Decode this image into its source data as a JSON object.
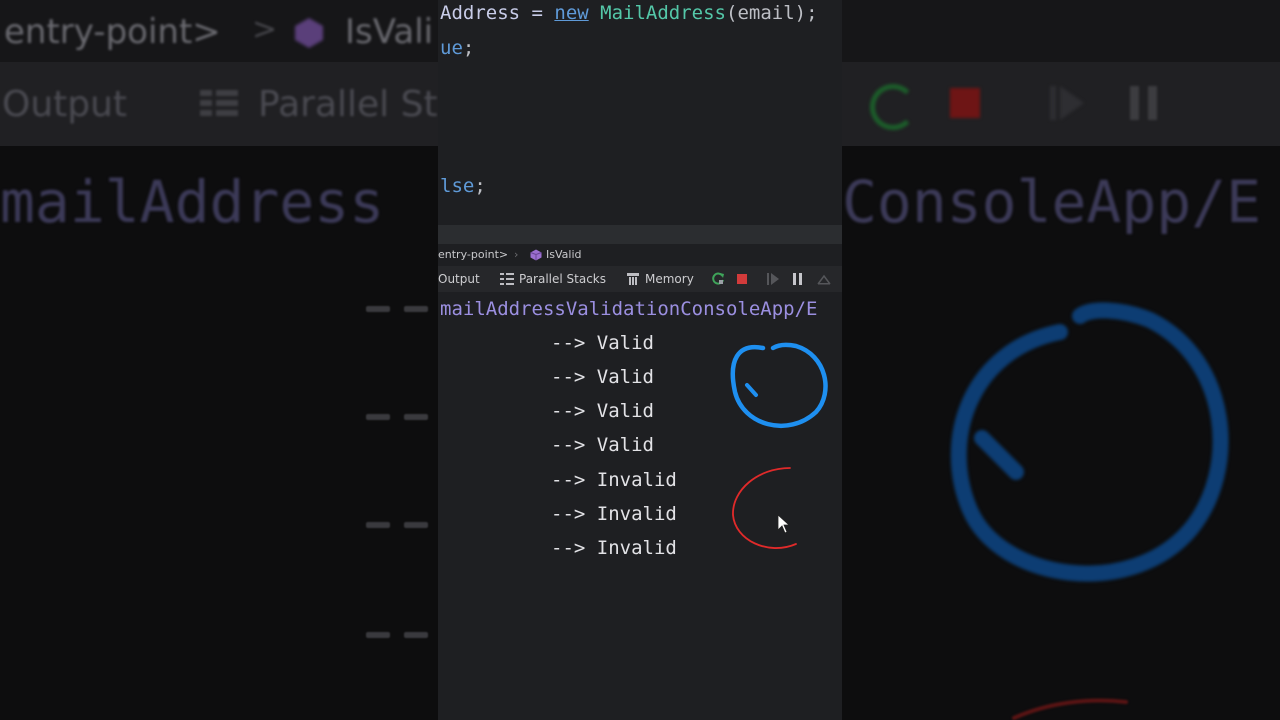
{
  "background": {
    "breadcrumb_left": "entry-point>",
    "breadcrumb_sep": ">",
    "breadcrumb_right": "IsVali",
    "tab_output": "Output",
    "tab_parallel": "Parallel St",
    "path_left": "mailAddress",
    "path_right": "ConsoleApp/E"
  },
  "editor": {
    "lines": [
      {
        "pre": "Address = ",
        "kw": "new",
        "cls": " MailAddress",
        "rest": "(email);"
      },
      {
        "kw": "ue",
        "rest": ";"
      },
      {
        "kw": "lse",
        "rest": ";"
      }
    ]
  },
  "breadcrumb": {
    "entry": "entry-point>",
    "sep": "›",
    "method": "IsValid",
    "method_icon": "method-cube-icon"
  },
  "toolbar": {
    "output": "Output",
    "parallel_stacks": "Parallel Stacks",
    "memory": "Memory",
    "icons": [
      "rerun-icon",
      "stop-icon",
      "resume-icon",
      "pause-icon",
      "step-icon"
    ],
    "colors": {
      "rerun": "#3fa45a",
      "stop": "#d23b3b"
    }
  },
  "console": {
    "path": "mailAddressValidationConsoleApp/E",
    "results": [
      "--> Valid",
      "--> Valid",
      "--> Valid",
      "--> Valid",
      "--> Invalid",
      "--> Invalid",
      "--> Invalid"
    ]
  },
  "annotations": {
    "valid_circle_color": "#1e8ff0",
    "invalid_circle_color": "#e02a2a"
  }
}
